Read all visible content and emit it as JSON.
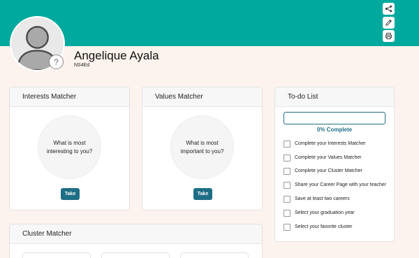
{
  "colors": {
    "header": "#00a99d",
    "page_bg": "#fdf3ee",
    "accent": "#1e6e86"
  },
  "header": {
    "icons": [
      "share-icon",
      "pencil-icon",
      "printer-icon"
    ]
  },
  "profile": {
    "name": "Angelique Ayala",
    "code": "NS4Ed",
    "help_glyph": "?"
  },
  "interests": {
    "title": "Interests Matcher",
    "prompt_line1": "What is most",
    "prompt_line2": "interesting to you?",
    "button": "Take"
  },
  "values": {
    "title": "Values Matcher",
    "prompt_line1": "What is most",
    "prompt_line2": "important to you?",
    "button": "Take"
  },
  "cluster": {
    "title": "Cluster Matcher"
  },
  "todo": {
    "title": "To-do List",
    "progress_percent": 0,
    "progress_label": "0% Complete",
    "items": [
      "Complete your Interests Matcher",
      "Complete your Values Matcher",
      "Complete your Cluster Matcher",
      "Share your Career Page with your teacher",
      "Save at least two careers",
      "Select your graduation year",
      "Select your favorite cluster"
    ]
  }
}
